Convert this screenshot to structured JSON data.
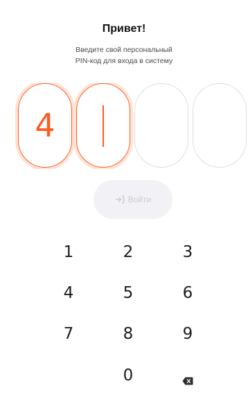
{
  "header": {
    "title": "Привет!",
    "subtitle_line1": "Введите свой персональный",
    "subtitle_line2": "PIN-код для входа в систему"
  },
  "pin": {
    "cells": [
      {
        "digit": "4",
        "state": "filled"
      },
      {
        "digit": "",
        "state": "cursor"
      },
      {
        "digit": "",
        "state": "empty"
      },
      {
        "digit": "",
        "state": "empty"
      }
    ]
  },
  "login_button": {
    "label": "Войти",
    "icon": "login-arrow-icon",
    "enabled": false
  },
  "keypad": {
    "keys": [
      "1",
      "2",
      "3",
      "4",
      "5",
      "6",
      "7",
      "8",
      "9",
      "0"
    ],
    "backspace_icon": "backspace-icon"
  },
  "colors": {
    "accent": "#ff5a1f",
    "accent_glow": "#ffe2d4",
    "cell_border": "#dcdcdf",
    "button_bg": "#f2f2f6",
    "button_text": "#c9c9d0",
    "text": "#1c1c1e"
  }
}
